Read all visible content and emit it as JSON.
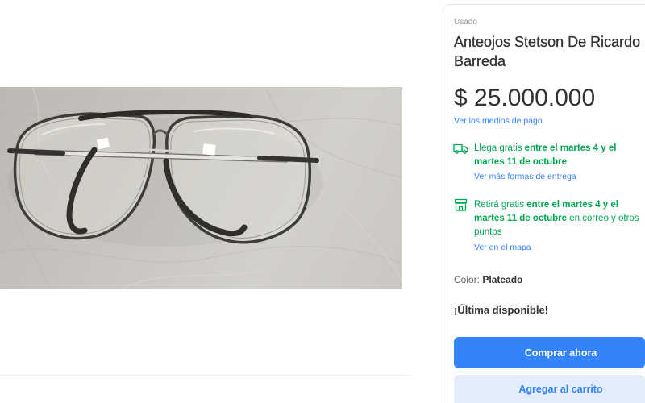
{
  "product": {
    "condition": "Usado",
    "title": "Anteojos Stetson De Ricardo Barreda",
    "price": "$ 25.000.000",
    "payment_link": "Ver los medios de pago"
  },
  "shipping": {
    "icon": "truck-icon",
    "highlight": "Llega gratis",
    "date": "entre el martes 4 y el martes 11 de octubre",
    "link": "Ver más formas de entrega"
  },
  "pickup": {
    "icon": "store-icon",
    "highlight": "Retirá gratis",
    "date": "entre el martes 4 y el martes 11 de octubre",
    "detail": "en correo y otros puntos",
    "link": "Ver en el mapa"
  },
  "variant": {
    "label": "Color:",
    "value": "Plateado"
  },
  "stock": "¡Última disponible!",
  "actions": {
    "buy": "Comprar ahora",
    "add_to_cart": "Agregar al carrito"
  },
  "colors": {
    "accent": "#3483fa",
    "success": "#00a650",
    "accent_soft": "#e3edfb",
    "text": "#333333",
    "muted": "#999999"
  }
}
